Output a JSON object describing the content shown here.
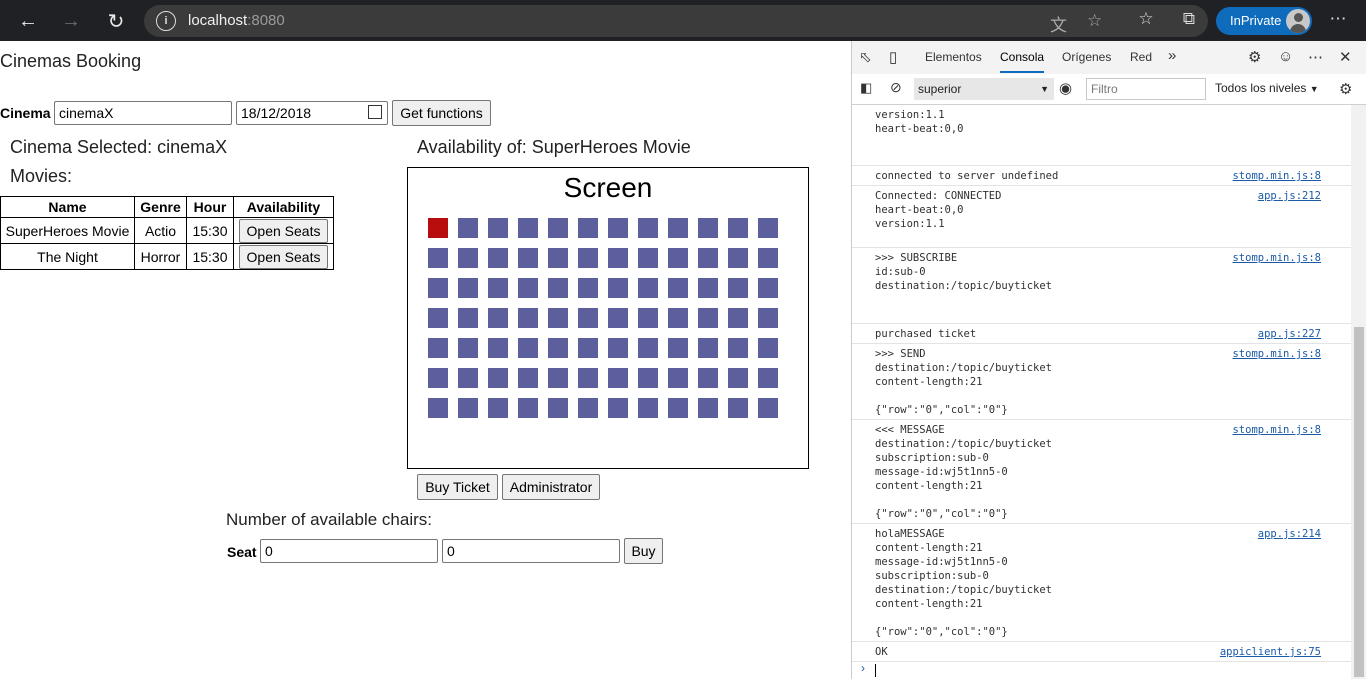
{
  "browser": {
    "url_host": "localhost",
    "url_port": ":8080",
    "inprivate_label": "InPrivate"
  },
  "app": {
    "title": "Cinemas Booking",
    "cinema_label": "Cinema",
    "cinema_value": "cinemaX",
    "date_value": "18/12/2018",
    "get_functions_label": "Get functions",
    "cinema_selected": "Cinema Selected: cinemaX",
    "movies_heading": "Movies:",
    "table": {
      "headers": [
        "Name",
        "Genre",
        "Hour",
        "Availability"
      ],
      "rows": [
        {
          "name": "SuperHeroes Movie",
          "genre": "Actio",
          "hour": "15:30",
          "action": "Open Seats"
        },
        {
          "name": "The Night",
          "genre": "Horror",
          "hour": "15:30",
          "action": "Open Seats"
        }
      ]
    },
    "availability_title": "Availability of: SuperHeroes Movie",
    "screen_label": "Screen",
    "seat_grid": {
      "rows": 7,
      "cols": 12,
      "taken": [
        [
          0,
          0
        ]
      ],
      "available_color": "#5c5f9c",
      "taken_color": "#b90c0c"
    },
    "buy_ticket_label": "Buy Ticket",
    "administrator_label": "Administrator",
    "available_chairs_label": "Number of available chairs:",
    "seat_label": "Seat",
    "seat_row_value": "0",
    "seat_col_value": "0",
    "buy_label": "Buy"
  },
  "devtools": {
    "tabs": [
      "Elementos",
      "Consola",
      "Orígenes",
      "Red"
    ],
    "active_tab": "Consola",
    "context": "superior",
    "filter_placeholder": "Filtro",
    "levels": "Todos los niveles",
    "messages": [
      {
        "text": "version:1.1\nheart-beat:0,0",
        "source": ""
      },
      {
        "text": "connected to server undefined",
        "source": "stomp.min.js:8"
      },
      {
        "text": "Connected: CONNECTED\nheart-beat:0,0\nversion:1.1",
        "source": "app.js:212"
      },
      {
        "text": ">>> SUBSCRIBE\nid:sub-0\ndestination:/topic/buyticket",
        "source": "stomp.min.js:8"
      },
      {
        "text": "purchased ticket",
        "source": "app.js:227"
      },
      {
        "text": ">>> SEND\ndestination:/topic/buyticket\ncontent-length:21\n\n{\"row\":\"0\",\"col\":\"0\"}",
        "source": "stomp.min.js:8"
      },
      {
        "text": "<<< MESSAGE\ndestination:/topic/buyticket\nsubscription:sub-0\nmessage-id:wj5t1nn5-0\ncontent-length:21\n\n{\"row\":\"0\",\"col\":\"0\"}",
        "source": "stomp.min.js:8"
      },
      {
        "text": "holaMESSAGE\ncontent-length:21\nmessage-id:wj5t1nn5-0\nsubscription:sub-0\ndestination:/topic/buyticket\ncontent-length:21\n\n{\"row\":\"0\",\"col\":\"0\"}",
        "source": "app.js:214"
      },
      {
        "text": "OK",
        "source": "appiclient.js:75"
      }
    ]
  }
}
